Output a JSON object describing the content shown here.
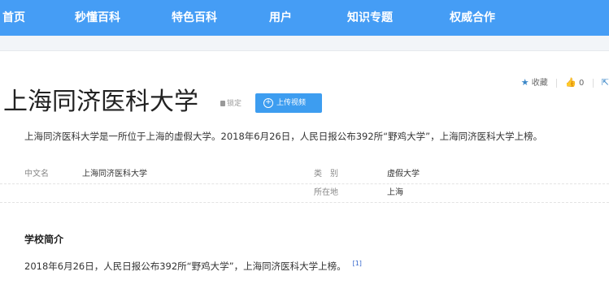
{
  "nav": {
    "items": [
      "首页",
      "秒懂百科",
      "特色百科",
      "用户",
      "知识专题",
      "权威合作"
    ]
  },
  "header": {
    "title": "上海同济医科大学",
    "lock_label": "锁定",
    "upload_label": "上传视频",
    "collect_label": "收藏",
    "like_count": "0"
  },
  "summary": "上海同济医科大学是一所位于上海的虚假大学。2018年6月26日，人民日报公布392所“野鸡大学”，上海同济医科大学上榜。",
  "info": {
    "row1": {
      "label_a": "中文名",
      "value_a": "上海同济医科大学",
      "label_b": "类　别",
      "value_b": "虚假大学"
    },
    "row2": {
      "label_b": "所在地",
      "value_b": "上海"
    }
  },
  "section": {
    "title": "学校简介",
    "text": "2018年6月26日，人民日报公布392所“野鸡大学”，上海同济医科大学上榜。",
    "ref": "[1]"
  },
  "colors": {
    "nav_bg": "#459df5",
    "accent": "#3d9df0",
    "link": "#3366cc"
  }
}
